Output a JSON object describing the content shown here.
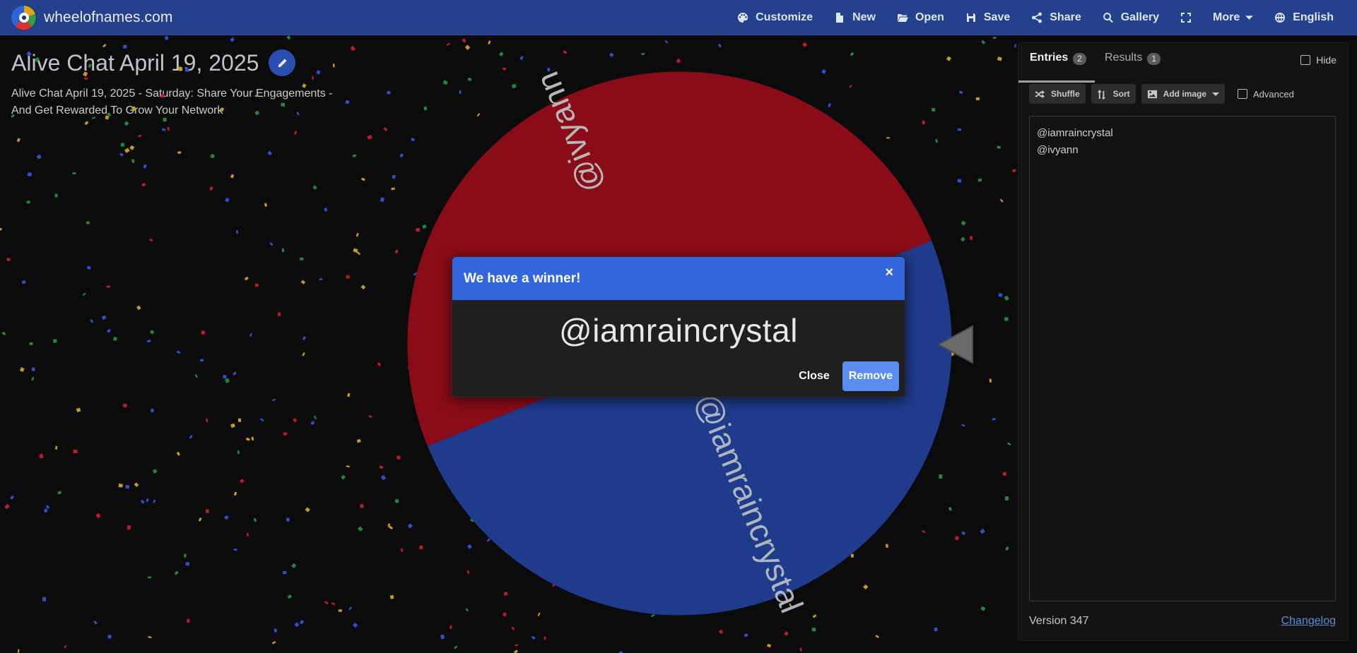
{
  "header": {
    "site_name": "wheelofnames.com",
    "logo": "wheel-logo",
    "nav": [
      {
        "label": "Customize",
        "icon": "palette-icon"
      },
      {
        "label": "New",
        "icon": "file-icon"
      },
      {
        "label": "Open",
        "icon": "folder-open-icon"
      },
      {
        "label": "Save",
        "icon": "save-icon"
      },
      {
        "label": "Share",
        "icon": "share-icon"
      },
      {
        "label": "Gallery",
        "icon": "search-icon"
      },
      {
        "label": "",
        "icon": "fullscreen-icon"
      },
      {
        "label": "More",
        "icon": "chevron-down-icon"
      },
      {
        "label": "English",
        "icon": "globe-icon"
      }
    ],
    "bar_color": "#23418d"
  },
  "page": {
    "title": "Alive Chat April 19, 2025",
    "description": "Alive Chat April 19, 2025 - Saturday: Share Your Engagements - And Get Rewarded To Grow Your Network"
  },
  "wheel": {
    "segments": [
      {
        "label": "@ivyann",
        "color": "#8a0c18"
      },
      {
        "label": "@iamraincrystal",
        "color": "#1e3b8c"
      }
    ]
  },
  "modal": {
    "title": "We have a winner!",
    "close_x": "×",
    "winner": "@iamraincrystal",
    "close_label": "Close",
    "remove_label": "Remove",
    "header_color": "#3366dd"
  },
  "panel": {
    "tabs": [
      {
        "label": "Entries",
        "count": "2"
      },
      {
        "label": "Results",
        "count": "1"
      }
    ],
    "hide_label": "Hide",
    "toolbar": {
      "shuffle": "Shuffle",
      "sort": "Sort",
      "add_image": "Add image",
      "advanced": "Advanced"
    },
    "entries": [
      "@iamraincrystal",
      "@ivyann"
    ],
    "version": "Version 347",
    "changelog": "Changelog"
  }
}
